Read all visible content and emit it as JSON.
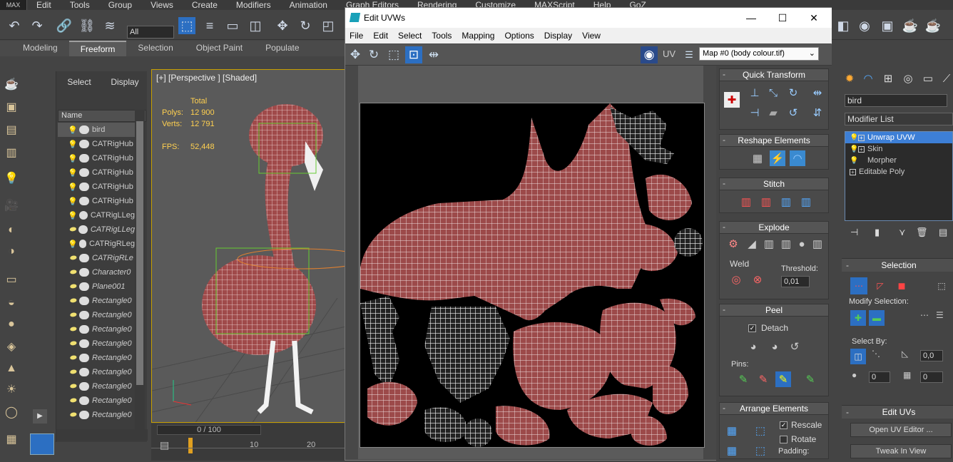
{
  "max_menu": {
    "logo": "MAX",
    "items": [
      "Edit",
      "Tools",
      "Group",
      "Views",
      "Create",
      "Modifiers",
      "Animation",
      "Graph Editors",
      "Rendering",
      "Customize",
      "MAXScript",
      "Help",
      "GoZ"
    ]
  },
  "toolbar": {
    "selection_filter": "All"
  },
  "ribbon": {
    "tabs": [
      "Modeling",
      "Freeform",
      "Selection",
      "Object Paint",
      "Populate"
    ],
    "active": "Freeform"
  },
  "scene_explorer": {
    "tabs": [
      "Select",
      "Display"
    ],
    "column_header": "Name",
    "rows": [
      {
        "name": "bird",
        "italic": false,
        "selected": true
      },
      {
        "name": "CATRigHub",
        "italic": false
      },
      {
        "name": "CATRigHub",
        "italic": false
      },
      {
        "name": "CATRigHub",
        "italic": false
      },
      {
        "name": "CATRigHub",
        "italic": false
      },
      {
        "name": "CATRigHub",
        "italic": false
      },
      {
        "name": "CATRigLLeg",
        "italic": false
      },
      {
        "name": "CATRigLLeg",
        "italic": true
      },
      {
        "name": "CATRigRLeg",
        "italic": false
      },
      {
        "name": "CATRigRLe",
        "italic": true
      },
      {
        "name": "Character0",
        "italic": true
      },
      {
        "name": "Plane001",
        "italic": true
      },
      {
        "name": "Rectangle0",
        "italic": true
      },
      {
        "name": "Rectangle0",
        "italic": true
      },
      {
        "name": "Rectangle0",
        "italic": true
      },
      {
        "name": "Rectangle0",
        "italic": true
      },
      {
        "name": "Rectangle0",
        "italic": true
      },
      {
        "name": "Rectangle0",
        "italic": true
      },
      {
        "name": "Rectangle0",
        "italic": true
      },
      {
        "name": "Rectangle0",
        "italic": true
      },
      {
        "name": "Rectangle0",
        "italic": true
      }
    ]
  },
  "viewport": {
    "label": "[+] [Perspective ] [Shaded]",
    "stats": {
      "total_label": "Total",
      "polys_label": "Polys:",
      "polys": "12 900",
      "verts_label": "Verts:",
      "verts": "12 791",
      "fps_label": "FPS:",
      "fps": "52,448"
    }
  },
  "timeline": {
    "frame": "0 / 100",
    "ticks": [
      "0",
      "10",
      "20"
    ]
  },
  "uvw_window": {
    "title": "Edit UVWs",
    "menu": [
      "File",
      "Edit",
      "Select",
      "Tools",
      "Mapping",
      "Options",
      "Display",
      "View"
    ],
    "uv_label": "UV",
    "map_select": "Map #0 (body colour.tif)",
    "rollouts": {
      "quick_transform": "Quick Transform",
      "reshape": "Reshape Elements",
      "stitch": "Stitch",
      "explode": "Explode",
      "weld": "Weld",
      "threshold_label": "Threshold:",
      "threshold": "0,01",
      "peel": "Peel",
      "detach": "Detach",
      "pins": "Pins:",
      "arrange": "Arrange Elements",
      "rescale": "Rescale",
      "rotate": "Rotate",
      "padding": "Padding:"
    }
  },
  "command_panel": {
    "object_name": "bird",
    "modifier_list": "Modifier List",
    "stack": [
      {
        "name": "Unwrap UVW",
        "selected": true
      },
      {
        "name": "Skin",
        "selected": false
      },
      {
        "name": "Morpher",
        "selected": false
      },
      {
        "name": "Editable Poly",
        "selected": false
      }
    ],
    "selection_head": "Selection",
    "modify_selection": "Modify Selection:",
    "select_by": "Select By:",
    "select_by_value": "0,0",
    "spinner_a": "0",
    "spinner_b": "0",
    "edit_uvs_head": "Edit UVs",
    "open_uv_editor": "Open UV Editor ...",
    "tweak_in_view": "Tweak In View"
  },
  "colors": {
    "accent_blue": "#3d7fd6",
    "uv_bg": "#000000",
    "viewport_border": "#c8a000",
    "stats_text": "#ffd050"
  }
}
